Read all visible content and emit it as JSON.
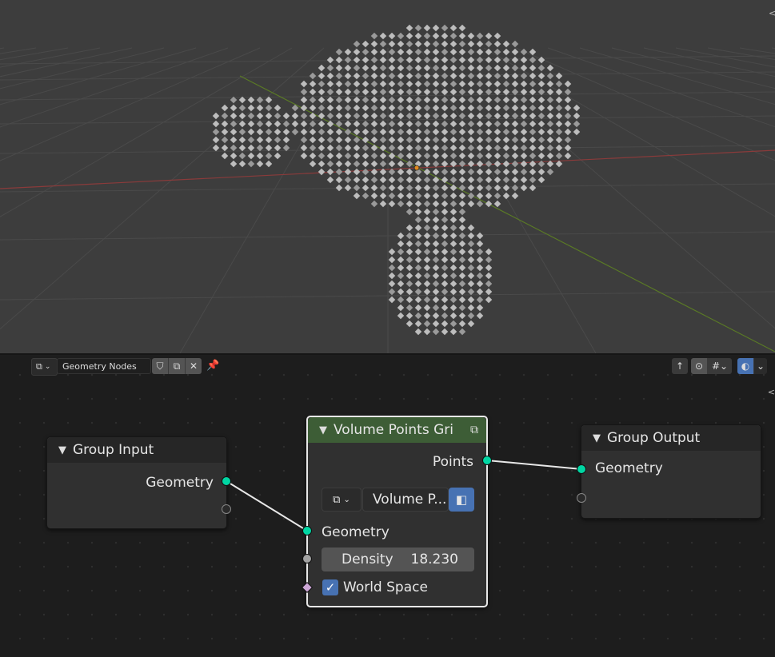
{
  "viewport": {
    "side_arrow": "<"
  },
  "node_editor": {
    "header": {
      "editor_type_icon": "node-tree-icon",
      "tree_name": "Geometry Nodes",
      "fake_user_icon": "shield-icon",
      "duplicate_icon": "duplicate-icon",
      "unlink_icon": "x-icon",
      "pin_icon": "pin-icon",
      "right_icons": [
        "parent-arrow-icon",
        "snap-icon",
        "grid-snap-icon",
        "overlay-icon"
      ]
    },
    "side_arrow": "<",
    "nodes": {
      "group_input": {
        "title": "Group Input",
        "outputs": [
          "Geometry"
        ]
      },
      "volume_points": {
        "title": "Volume Points Gri",
        "output": "Points",
        "data_block_label": "Volume P...",
        "input_geometry": "Geometry",
        "density_label": "Density",
        "density_value": "18.230",
        "world_space_label": "World Space",
        "world_space_checked": true
      },
      "group_output": {
        "title": "Group Output",
        "inputs": [
          "Geometry"
        ]
      }
    },
    "colors": {
      "geometry_socket": "#00d6a3",
      "node_header_green": "#3d5d36",
      "checkbox_blue": "#4772b3"
    }
  }
}
